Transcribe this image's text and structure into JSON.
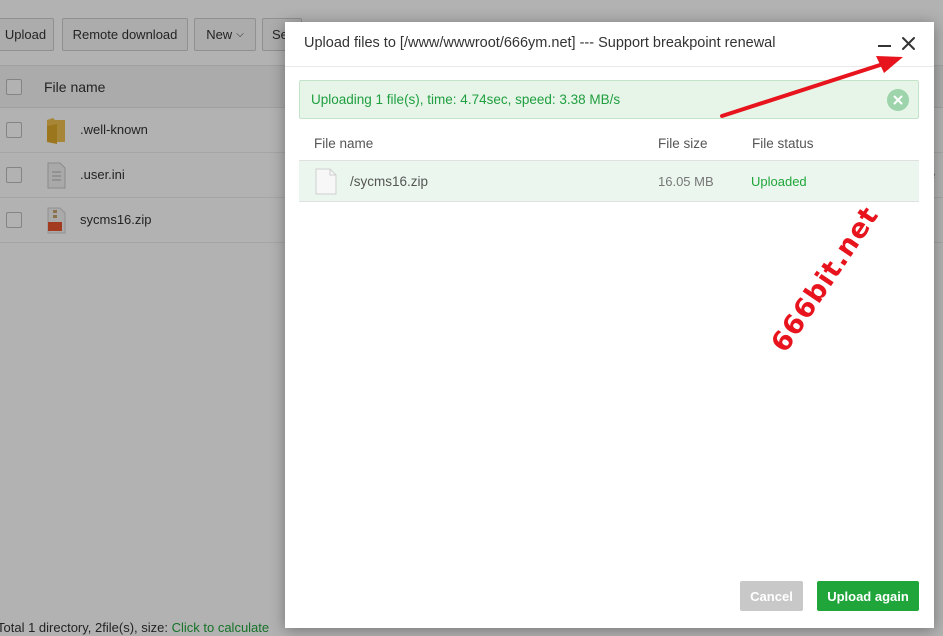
{
  "toolbar": {
    "buttons": [
      {
        "label": "Upload"
      },
      {
        "label": "Remote download"
      },
      {
        "label": "New"
      },
      {
        "label": "Se"
      }
    ]
  },
  "file_table": {
    "header_name": "File name",
    "rows": [
      {
        "name": ".well-known",
        "icon": "folder-icon"
      },
      {
        "name": ".user.ini",
        "icon": "text-file-icon"
      },
      {
        "name": "sycms16.zip",
        "icon": "zip-file-icon"
      }
    ],
    "row2_right_fragment": "e"
  },
  "footer": {
    "summary": "Total 1 directory, 2file(s), size: ",
    "calc_link": "Click to calculate"
  },
  "dialog": {
    "title": "Upload files to [/www/wwwroot/666ym.net] --- Support breakpoint renewal",
    "alert": "Uploading 1 file(s), time: 4.74sec, speed: 3.38 MB/s",
    "columns": {
      "name": "File name",
      "size": "File size",
      "status": "File status"
    },
    "uploads": [
      {
        "name": "/sycms16.zip",
        "size": "16.05 MB",
        "status": "Uploaded"
      }
    ],
    "cancel_label": "Cancel",
    "upload_again_label": "Upload again"
  },
  "watermark": "666bit.net",
  "colors": {
    "accent": "#20a53a",
    "alert_bg": "#e7f5e9",
    "cancel_bg": "#c8c8c8",
    "annotation_arrow": "#e8141d"
  }
}
